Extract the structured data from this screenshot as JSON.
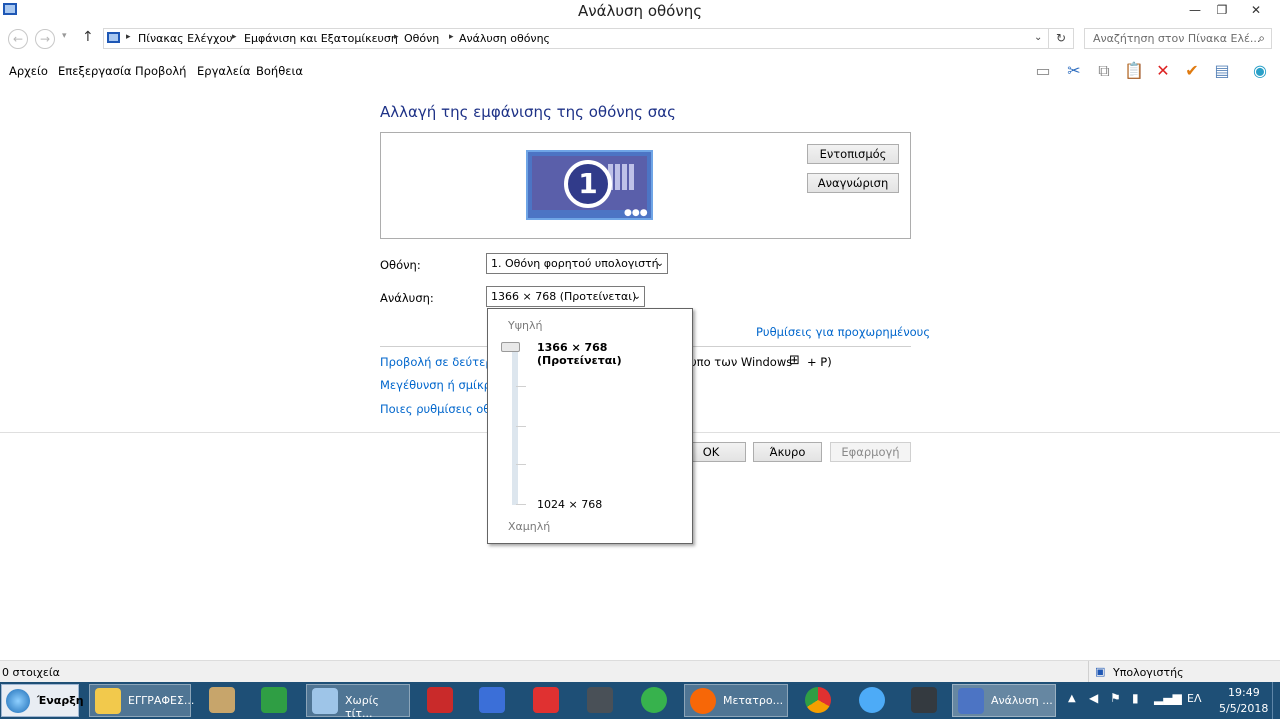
{
  "window": {
    "title": "Ανάλυση οθόνης"
  },
  "address": {
    "crumbs": [
      "Πίνακας Ελέγχου",
      "Εμφάνιση και Εξατομίκευση",
      "Οθόνη",
      "Ανάλυση οθόνης"
    ],
    "search_placeholder": "Αναζήτηση στον Πίνακα Ελέ..."
  },
  "menu": [
    "Αρχείο",
    "Επεξεργασία",
    "Προβολή",
    "Εργαλεία",
    "Βοήθεια"
  ],
  "content": {
    "heading": "Αλλαγή της εμφάνισης της οθόνης σας",
    "monitor_number": "1",
    "detect_button": "Εντοπισμός",
    "identify_button": "Αναγνώριση",
    "display_label": "Οθόνη:",
    "display_value": "1. Οθόνη φορητού υπολογιστή",
    "resolution_label": "Ανάλυση:",
    "resolution_value": "1366 × 768 (Προτείνεται)",
    "advanced_link": "Ρυθμίσεις για προχωρημένους",
    "link1": "Προβολή σε δεύτερη",
    "link1_tail": "υπο των Windows",
    "link1_key": "+ P)",
    "link2": "Μεγέθυνση ή σμίκρυν",
    "link3": "Ποιες ρυθμίσεις οθόν",
    "ok": "OK",
    "cancel": "Άκυρο",
    "apply": "Εφαρμογή"
  },
  "dropdown": {
    "high": "Υψηλή",
    "selected": "1366 × 768 (Προτείνεται)",
    "min_value": "1024 × 768",
    "low": "Χαμηλή",
    "slider_level": 1.0
  },
  "status": {
    "items": "0 στοιχεία",
    "location": "Υπολογιστής"
  },
  "taskbar": {
    "start": "Έναρξη",
    "tasks": [
      "ΕΓΓΡΑΦΕΣ...",
      "Χωρίς τίτ...",
      "Μετατρο...",
      "Ανάλυση ..."
    ],
    "language": "ΕΛ",
    "time": "19:49",
    "date": "5/5/2018"
  },
  "colors": {
    "link": "#0066cc",
    "heading": "#1e3287",
    "taskbar": "#1e4f76"
  }
}
